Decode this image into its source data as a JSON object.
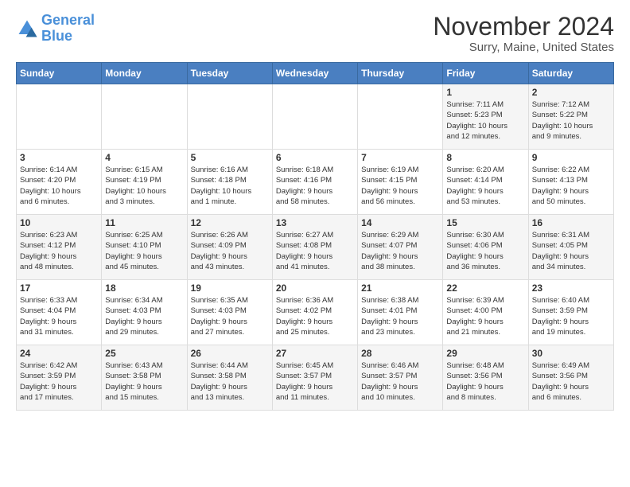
{
  "logo": {
    "line1": "General",
    "line2": "Blue"
  },
  "title": "November 2024",
  "location": "Surry, Maine, United States",
  "days_of_week": [
    "Sunday",
    "Monday",
    "Tuesday",
    "Wednesday",
    "Thursday",
    "Friday",
    "Saturday"
  ],
  "weeks": [
    [
      {
        "day": "",
        "info": ""
      },
      {
        "day": "",
        "info": ""
      },
      {
        "day": "",
        "info": ""
      },
      {
        "day": "",
        "info": ""
      },
      {
        "day": "",
        "info": ""
      },
      {
        "day": "1",
        "info": "Sunrise: 7:11 AM\nSunset: 5:23 PM\nDaylight: 10 hours\nand 12 minutes."
      },
      {
        "day": "2",
        "info": "Sunrise: 7:12 AM\nSunset: 5:22 PM\nDaylight: 10 hours\nand 9 minutes."
      }
    ],
    [
      {
        "day": "3",
        "info": "Sunrise: 6:14 AM\nSunset: 4:20 PM\nDaylight: 10 hours\nand 6 minutes."
      },
      {
        "day": "4",
        "info": "Sunrise: 6:15 AM\nSunset: 4:19 PM\nDaylight: 10 hours\nand 3 minutes."
      },
      {
        "day": "5",
        "info": "Sunrise: 6:16 AM\nSunset: 4:18 PM\nDaylight: 10 hours\nand 1 minute."
      },
      {
        "day": "6",
        "info": "Sunrise: 6:18 AM\nSunset: 4:16 PM\nDaylight: 9 hours\nand 58 minutes."
      },
      {
        "day": "7",
        "info": "Sunrise: 6:19 AM\nSunset: 4:15 PM\nDaylight: 9 hours\nand 56 minutes."
      },
      {
        "day": "8",
        "info": "Sunrise: 6:20 AM\nSunset: 4:14 PM\nDaylight: 9 hours\nand 53 minutes."
      },
      {
        "day": "9",
        "info": "Sunrise: 6:22 AM\nSunset: 4:13 PM\nDaylight: 9 hours\nand 50 minutes."
      }
    ],
    [
      {
        "day": "10",
        "info": "Sunrise: 6:23 AM\nSunset: 4:12 PM\nDaylight: 9 hours\nand 48 minutes."
      },
      {
        "day": "11",
        "info": "Sunrise: 6:25 AM\nSunset: 4:10 PM\nDaylight: 9 hours\nand 45 minutes."
      },
      {
        "day": "12",
        "info": "Sunrise: 6:26 AM\nSunset: 4:09 PM\nDaylight: 9 hours\nand 43 minutes."
      },
      {
        "day": "13",
        "info": "Sunrise: 6:27 AM\nSunset: 4:08 PM\nDaylight: 9 hours\nand 41 minutes."
      },
      {
        "day": "14",
        "info": "Sunrise: 6:29 AM\nSunset: 4:07 PM\nDaylight: 9 hours\nand 38 minutes."
      },
      {
        "day": "15",
        "info": "Sunrise: 6:30 AM\nSunset: 4:06 PM\nDaylight: 9 hours\nand 36 minutes."
      },
      {
        "day": "16",
        "info": "Sunrise: 6:31 AM\nSunset: 4:05 PM\nDaylight: 9 hours\nand 34 minutes."
      }
    ],
    [
      {
        "day": "17",
        "info": "Sunrise: 6:33 AM\nSunset: 4:04 PM\nDaylight: 9 hours\nand 31 minutes."
      },
      {
        "day": "18",
        "info": "Sunrise: 6:34 AM\nSunset: 4:03 PM\nDaylight: 9 hours\nand 29 minutes."
      },
      {
        "day": "19",
        "info": "Sunrise: 6:35 AM\nSunset: 4:03 PM\nDaylight: 9 hours\nand 27 minutes."
      },
      {
        "day": "20",
        "info": "Sunrise: 6:36 AM\nSunset: 4:02 PM\nDaylight: 9 hours\nand 25 minutes."
      },
      {
        "day": "21",
        "info": "Sunrise: 6:38 AM\nSunset: 4:01 PM\nDaylight: 9 hours\nand 23 minutes."
      },
      {
        "day": "22",
        "info": "Sunrise: 6:39 AM\nSunset: 4:00 PM\nDaylight: 9 hours\nand 21 minutes."
      },
      {
        "day": "23",
        "info": "Sunrise: 6:40 AM\nSunset: 3:59 PM\nDaylight: 9 hours\nand 19 minutes."
      }
    ],
    [
      {
        "day": "24",
        "info": "Sunrise: 6:42 AM\nSunset: 3:59 PM\nDaylight: 9 hours\nand 17 minutes."
      },
      {
        "day": "25",
        "info": "Sunrise: 6:43 AM\nSunset: 3:58 PM\nDaylight: 9 hours\nand 15 minutes."
      },
      {
        "day": "26",
        "info": "Sunrise: 6:44 AM\nSunset: 3:58 PM\nDaylight: 9 hours\nand 13 minutes."
      },
      {
        "day": "27",
        "info": "Sunrise: 6:45 AM\nSunset: 3:57 PM\nDaylight: 9 hours\nand 11 minutes."
      },
      {
        "day": "28",
        "info": "Sunrise: 6:46 AM\nSunset: 3:57 PM\nDaylight: 9 hours\nand 10 minutes."
      },
      {
        "day": "29",
        "info": "Sunrise: 6:48 AM\nSunset: 3:56 PM\nDaylight: 9 hours\nand 8 minutes."
      },
      {
        "day": "30",
        "info": "Sunrise: 6:49 AM\nSunset: 3:56 PM\nDaylight: 9 hours\nand 6 minutes."
      }
    ]
  ]
}
